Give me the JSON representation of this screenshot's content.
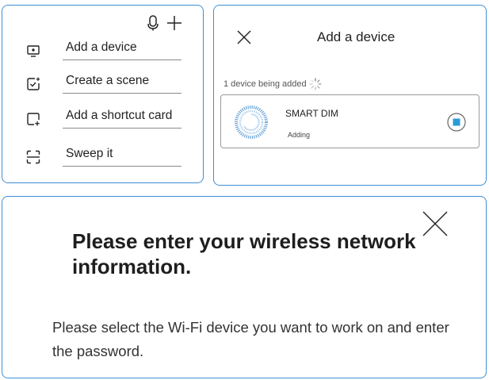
{
  "menu": {
    "items": [
      {
        "label": "Add a device",
        "icon": "add-device-icon"
      },
      {
        "label": "Create a scene",
        "icon": "create-scene-icon"
      },
      {
        "label": "Add a shortcut card",
        "icon": "shortcut-card-icon"
      },
      {
        "label": "Sweep it",
        "icon": "scan-icon"
      }
    ]
  },
  "add_device": {
    "title": "Add a device",
    "status": "1 device being added",
    "device": {
      "name": "SMART DIM",
      "state": "Adding"
    }
  },
  "wifi_dialog": {
    "title": "Please enter your wireless network information.",
    "description": "Please select the Wi-Fi device you want to work on and enter the password."
  },
  "colors": {
    "accent": "#3d8fd6",
    "stop_fill": "#2b9ad9"
  }
}
